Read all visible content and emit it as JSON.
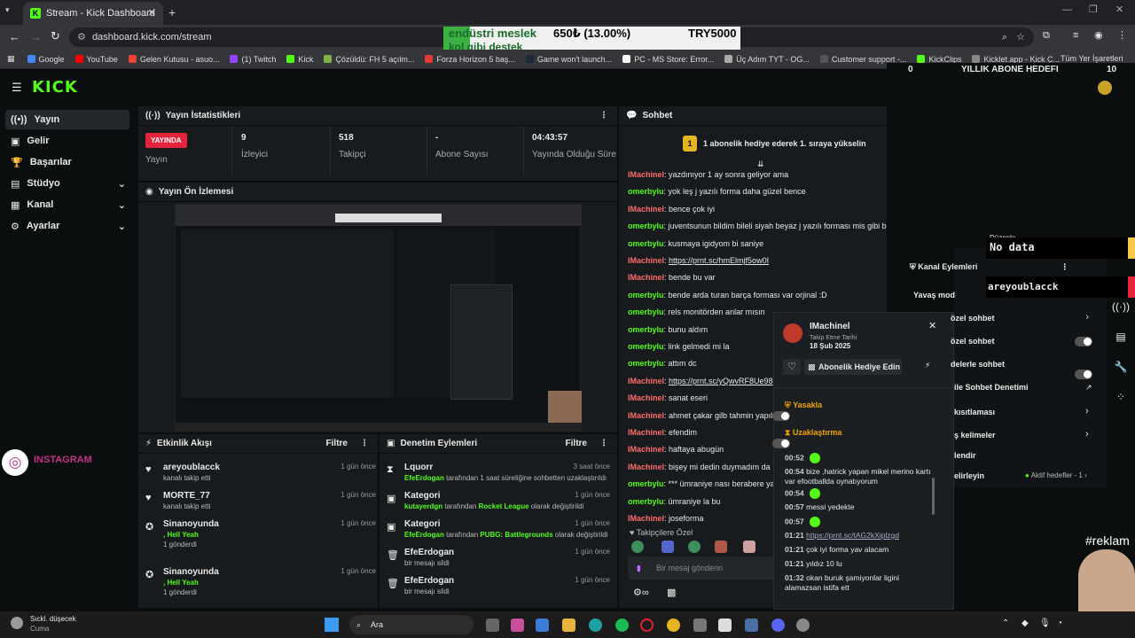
{
  "browser": {
    "tab_title": "Stream - Kick Dashboard",
    "url": "dashboard.kick.com/stream",
    "bookmarks": [
      "Google",
      "YouTube",
      "Gelen Kutusu - asuo...",
      "(1) Twitch",
      "Kick",
      "Çözüldü: FH 5 açılm...",
      "Forza Horizon 5 baş...",
      "Game won't launch...",
      "PC - MS Store: Error...",
      "Üç Adım TYT - OG...",
      "Customer support -...",
      "KickClips",
      "Kicklet.app - Kick C..."
    ],
    "all_bookmarks": "Tüm Yer İşaretleri"
  },
  "overlay": {
    "ticker1": "endüstri meslek",
    "ticker1b": "kol gibi destek",
    "price": "650₺ (13.00%)",
    "total": "TRY5000",
    "goal_left": "0",
    "goal_title": "YILLIK ABONE HEDEFI",
    "goal_right": "10",
    "no_data": "No data",
    "follower_name": "areyoublacck",
    "reklam": "#reklam",
    "instagram": "INSTAGRAM"
  },
  "logo": "KICK",
  "sidebar": {
    "items": [
      {
        "label": "Yayın"
      },
      {
        "label": "Gelir"
      },
      {
        "label": "Başarılar"
      },
      {
        "label": "Stüdyo"
      },
      {
        "label": "Kanal"
      },
      {
        "label": "Ayarlar"
      }
    ]
  },
  "stats": {
    "title": "Yayın İstatistikleri",
    "live_badge": "YAYINDA",
    "live_label": "Yayın",
    "viewers": "9",
    "viewers_label": "İzleyici",
    "followers": "518",
    "followers_label": "Takipçi",
    "subs": "-",
    "subs_label": "Abone Sayısı",
    "duration": "04:43:57",
    "duration_label": "Yayında Olduğu Süre"
  },
  "preview": {
    "title": "Yayın Ön İzlemesi"
  },
  "activity": {
    "title": "Etkinlik Akışı",
    "filter": "Filtre",
    "events": [
      {
        "name": "areyoublacck",
        "sub": "kanalı takip etti",
        "time": "1 gün önce"
      },
      {
        "name": "MORTE_77",
        "sub": "kanalı takip etti",
        "time": "1 gün önce"
      },
      {
        "name": "Sinanoyunda",
        "sub2": ", Hell Yeah",
        "sub": "1 gönderdi",
        "time": "1 gün önce"
      },
      {
        "name": "Sinanoyunda",
        "sub2": ", Hell Yeah",
        "sub": "1 gönderdi",
        "time": "1 gün önce"
      }
    ]
  },
  "moderation": {
    "title": "Denetim Eylemleri",
    "filter": "Filtre",
    "events": [
      {
        "name": "Lquorr",
        "who": "EfeErdogan",
        "sub": "tarafından 1 saat süreliğine sohbetten uzaklaştırıldı",
        "time": "3 saat önce"
      },
      {
        "name": "Kategori",
        "who": "kutayerdgn",
        "sub": "tarafından",
        "game": "Rocket League",
        "sub3": "olarak değiştirildi",
        "time": "1 gün önce"
      },
      {
        "name": "Kategori",
        "who": "EfeErdogan",
        "sub": "tarafından",
        "game": "PUBG: Battlegrounds",
        "sub3": "olarak değiştirildi",
        "time": "1 gün önce"
      },
      {
        "name": "EfeErdogan",
        "sub": "bir mesajı sildi",
        "time": "1 gün önce"
      },
      {
        "name": "EfeErdogan",
        "sub": "bir mesajı sildi",
        "time": "1 gün önce"
      }
    ]
  },
  "chat": {
    "title": "Sohbet",
    "pinned": "1 abonelik hediye ederek 1. sıraya yükselin",
    "followers_only": "Takipçilere Özel",
    "input_placeholder": "Bir mesaj gönderin",
    "messages": [
      {
        "user": "IMachinel",
        "text": "yazdınıyor 1 ay sonra geliyor ama"
      },
      {
        "user": "omerbylu",
        "text": "yok leş j yazılı forma daha güzel bence"
      },
      {
        "user": "IMachinel",
        "text": "bence çok iyi"
      },
      {
        "user": "omerbylu",
        "text": "juventsunun bildim bileli siyah beyaz j yazılı forması mis gibi bence"
      },
      {
        "user": "omerbylu",
        "text": "kusmaya igidyom bi saniye"
      },
      {
        "user": "IMachinel",
        "text": "https://prnt.sc/hmElmjf5ow0I"
      },
      {
        "user": "IMachinel",
        "text": "bende bu var"
      },
      {
        "user": "omerbylu",
        "text": "bende arda turan barça forması var orjinal :D"
      },
      {
        "user": "omerbylu",
        "text": "rels monitörden anlar mısın"
      },
      {
        "user": "omerbylu",
        "text": "bunu aldım"
      },
      {
        "user": "omerbylu",
        "text": "link gelmedi mi la"
      },
      {
        "user": "omerbylu",
        "text": "attım dc"
      },
      {
        "user": "IMachinel",
        "text": "https://prnt.sc/yQwvRF8Ue98"
      },
      {
        "user": "IMachinel",
        "text": "sanat eseri"
      },
      {
        "user": "IMachinel",
        "text": "ahmet çakar gilb tahmin yapıla"
      },
      {
        "user": "IMachinel",
        "text": "efendim"
      },
      {
        "user": "IMachinel",
        "text": "haftaya abugün"
      },
      {
        "user": "IMachinel",
        "text": "bişey mi dedin duymadım da"
      },
      {
        "user": "omerbylu",
        "text": "*** ümraniye nası berabere ya"
      },
      {
        "user": "omerbylu",
        "text": "ümraniye la bu"
      },
      {
        "user": "IMachinel",
        "text": "joseforma"
      }
    ]
  },
  "user_card": {
    "name": "IMachinel",
    "follow_label": "Takip Etme Tarihi",
    "follow_date": "18 Şub 2025",
    "gift_button": "Abonelik Hediye Edin",
    "ban": "Yasakla",
    "timeout": "Uzaklaştırma",
    "log": [
      {
        "t": "00:52",
        "m": ""
      },
      {
        "t": "00:54",
        "m": "bize ,hatrick yapan mikel merino kartı var efootballda oynatıyorum"
      },
      {
        "t": "00:54",
        "m": ""
      },
      {
        "t": "00:57",
        "m": "messi yedekte"
      },
      {
        "t": "00:57",
        "m": ""
      },
      {
        "t": "01:21",
        "m": "https://prnt.sc/tAG2kXiplzgd"
      },
      {
        "t": "01:21",
        "m": "çok iyi forma yav alacam"
      },
      {
        "t": "01:21",
        "m": "yıldız 10 lu"
      },
      {
        "t": "01:32",
        "m": "okan buruk şamiyonlar ligini alamazsan istifa ett"
      }
    ]
  },
  "channel_actions": {
    "edit": "Düzenle",
    "title": "Kanal Eylemleri",
    "slow": "Yavaş mod",
    "rows": [
      "özel sohbet",
      "özel sohbet",
      "delerle sohbet",
      "ile Sohbet Denetimi",
      "kısıtlaması",
      "ş kelimeler",
      "lendir",
      "elirleyin"
    ],
    "active_goals": "Aktif hedefler - 1"
  },
  "taskbar": {
    "weather": "Sıckl. düşecek",
    "weather2": "Cuma",
    "search": "Ara"
  }
}
